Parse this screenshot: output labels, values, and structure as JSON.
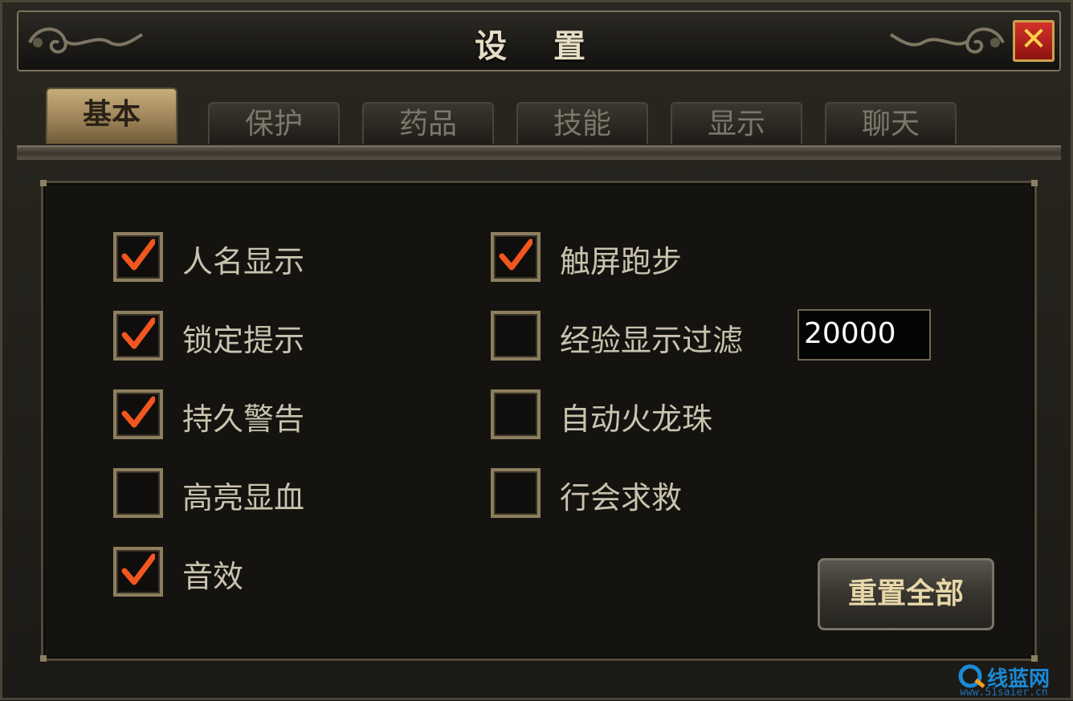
{
  "window": {
    "title": "设 置",
    "close_glyph": "✕"
  },
  "tabs": [
    {
      "label": "基本",
      "active": true
    },
    {
      "label": "保护",
      "active": false
    },
    {
      "label": "药品",
      "active": false
    },
    {
      "label": "技能",
      "active": false
    },
    {
      "label": "显示",
      "active": false
    },
    {
      "label": "聊天",
      "active": false
    }
  ],
  "options": {
    "left": [
      {
        "label": "人名显示",
        "checked": true
      },
      {
        "label": "锁定提示",
        "checked": true
      },
      {
        "label": "持久警告",
        "checked": true
      },
      {
        "label": "高亮显血",
        "checked": false
      },
      {
        "label": "音效",
        "checked": true
      }
    ],
    "right": [
      {
        "label": "触屏跑步",
        "checked": true
      },
      {
        "label": "经验显示过滤",
        "checked": false
      },
      {
        "label": "自动火龙珠",
        "checked": false
      },
      {
        "label": "行会求救",
        "checked": false
      }
    ]
  },
  "exp_filter": {
    "value": "20000"
  },
  "reset_button": {
    "label": "重置全部"
  },
  "watermark": {
    "text": "线蓝网",
    "url": "www.51saier.cn"
  },
  "colors": {
    "check": "#f2561f",
    "accent_gold": "#c6ad7a",
    "close_red": "#c0271f"
  }
}
